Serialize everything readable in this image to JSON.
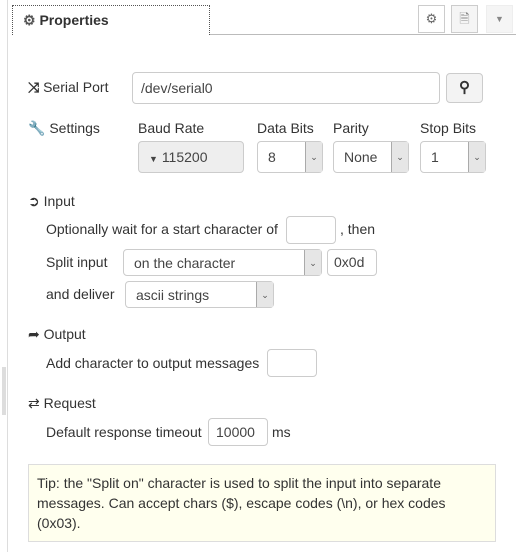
{
  "tab": {
    "icon": "gear-icon",
    "label": "Properties"
  },
  "toolbar": {
    "settings_icon": "gear-icon",
    "description_icon": "file-icon",
    "menu_icon": "caret-down-icon"
  },
  "serial_port": {
    "icon": "shuffle-icon",
    "label": "Serial Port",
    "value": "/dev/serial0",
    "search_icon": "search-icon"
  },
  "settings": {
    "icon": "wrench-icon",
    "label": "Settings",
    "baud_rate": {
      "label": "Baud Rate",
      "value": "115200"
    },
    "data_bits": {
      "label": "Data Bits",
      "value": "8"
    },
    "parity": {
      "label": "Parity",
      "value": "None"
    },
    "stop_bits": {
      "label": "Stop Bits",
      "value": "1"
    }
  },
  "input": {
    "icon": "sign-in-icon",
    "label": "Input",
    "wait_text": "Optionally wait for a start character of",
    "wait_value": "",
    "then_text": ", then",
    "split_label": "Split input",
    "split_value": "on the character",
    "split_char": "0x0d",
    "deliver_label": "and deliver",
    "deliver_value": "ascii strings"
  },
  "output": {
    "icon": "sign-out-icon",
    "label": "Output",
    "add_char_text": "Add character to output messages",
    "add_char_value": ""
  },
  "request": {
    "icon": "exchange-icon",
    "label": "Request",
    "timeout_text": "Default response timeout",
    "timeout_value": "10000",
    "unit": "ms"
  },
  "tip": "Tip: the \"Split on\" character is used to split the input into separate messages. Can accept chars ($), escape codes (\\n), or hex codes (0x03)."
}
